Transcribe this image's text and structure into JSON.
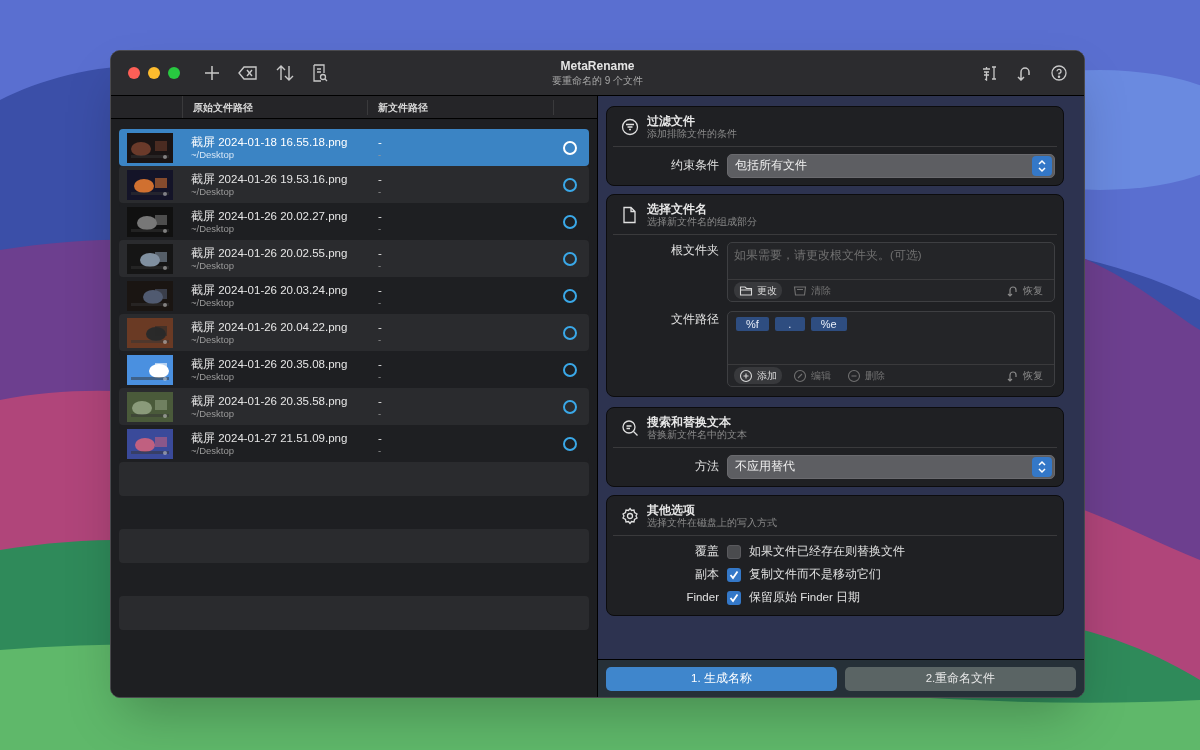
{
  "window": {
    "title": "MetaRename",
    "subtitle": "要重命名的 9 个文件"
  },
  "columns": [
    "原始文件路径",
    "新文件路径"
  ],
  "files": [
    {
      "name": "截屏 2024-01-18 16.55.18.png",
      "path": "~/Desktop",
      "new_name": "-",
      "new_path": "-",
      "selected": true
    },
    {
      "name": "截屏 2024-01-26 19.53.16.png",
      "path": "~/Desktop",
      "new_name": "-",
      "new_path": "-",
      "selected": false
    },
    {
      "name": "截屏 2024-01-26 20.02.27.png",
      "path": "~/Desktop",
      "new_name": "-",
      "new_path": "-",
      "selected": false
    },
    {
      "name": "截屏 2024-01-26 20.02.55.png",
      "path": "~/Desktop",
      "new_name": "-",
      "new_path": "-",
      "selected": false
    },
    {
      "name": "截屏 2024-01-26 20.03.24.png",
      "path": "~/Desktop",
      "new_name": "-",
      "new_path": "-",
      "selected": false
    },
    {
      "name": "截屏 2024-01-26 20.04.22.png",
      "path": "~/Desktop",
      "new_name": "-",
      "new_path": "-",
      "selected": false
    },
    {
      "name": "截屏 2024-01-26 20.35.08.png",
      "path": "~/Desktop",
      "new_name": "-",
      "new_path": "-",
      "selected": false
    },
    {
      "name": "截屏 2024-01-26 20.35.58.png",
      "path": "~/Desktop",
      "new_name": "-",
      "new_path": "-",
      "selected": false
    },
    {
      "name": "截屏 2024-01-27 21.51.09.png",
      "path": "~/Desktop",
      "new_name": "-",
      "new_path": "-",
      "selected": false
    }
  ],
  "filter": {
    "title": "过滤文件",
    "subtitle": "添加排除文件的条件",
    "label": "约束条件",
    "value": "包括所有文件"
  },
  "naming": {
    "title": "选择文件名",
    "subtitle": "选择新文件名的组成部分",
    "root": {
      "label": "根文件夹",
      "placeholder": "如果需要，请更改根文件夹。(可选)",
      "actions": [
        {
          "label": "更改",
          "kind": "folder",
          "disabled": false
        },
        {
          "label": "清除",
          "kind": "tray",
          "disabled": true
        }
      ],
      "restore": "恢复"
    },
    "path": {
      "label": "文件路径",
      "tokens": [
        "%f",
        ".",
        "%e"
      ],
      "actions": [
        {
          "label": "添加",
          "kind": "plus",
          "disabled": false
        },
        {
          "label": "编辑",
          "kind": "pencil",
          "disabled": true
        },
        {
          "label": "删除",
          "kind": "minus",
          "disabled": true
        }
      ],
      "restore": "恢复"
    }
  },
  "replace": {
    "title": "搜索和替换文本",
    "subtitle": "替换新文件名中的文本",
    "label": "方法",
    "value": "不应用替代"
  },
  "options": {
    "title": "其他选项",
    "subtitle": "选择文件在磁盘上的写入方式",
    "items": [
      {
        "label": "覆盖",
        "text": "如果文件已经存在则替换文件",
        "checked": false
      },
      {
        "label": "副本",
        "text": "复制文件而不是移动它们",
        "checked": true
      },
      {
        "label": "Finder",
        "text": "保留原始 Finder 日期",
        "checked": true
      }
    ]
  },
  "buttons": [
    {
      "label": "1. 生成名称",
      "primary": true
    },
    {
      "label": "2.重命名文件",
      "primary": false
    }
  ]
}
